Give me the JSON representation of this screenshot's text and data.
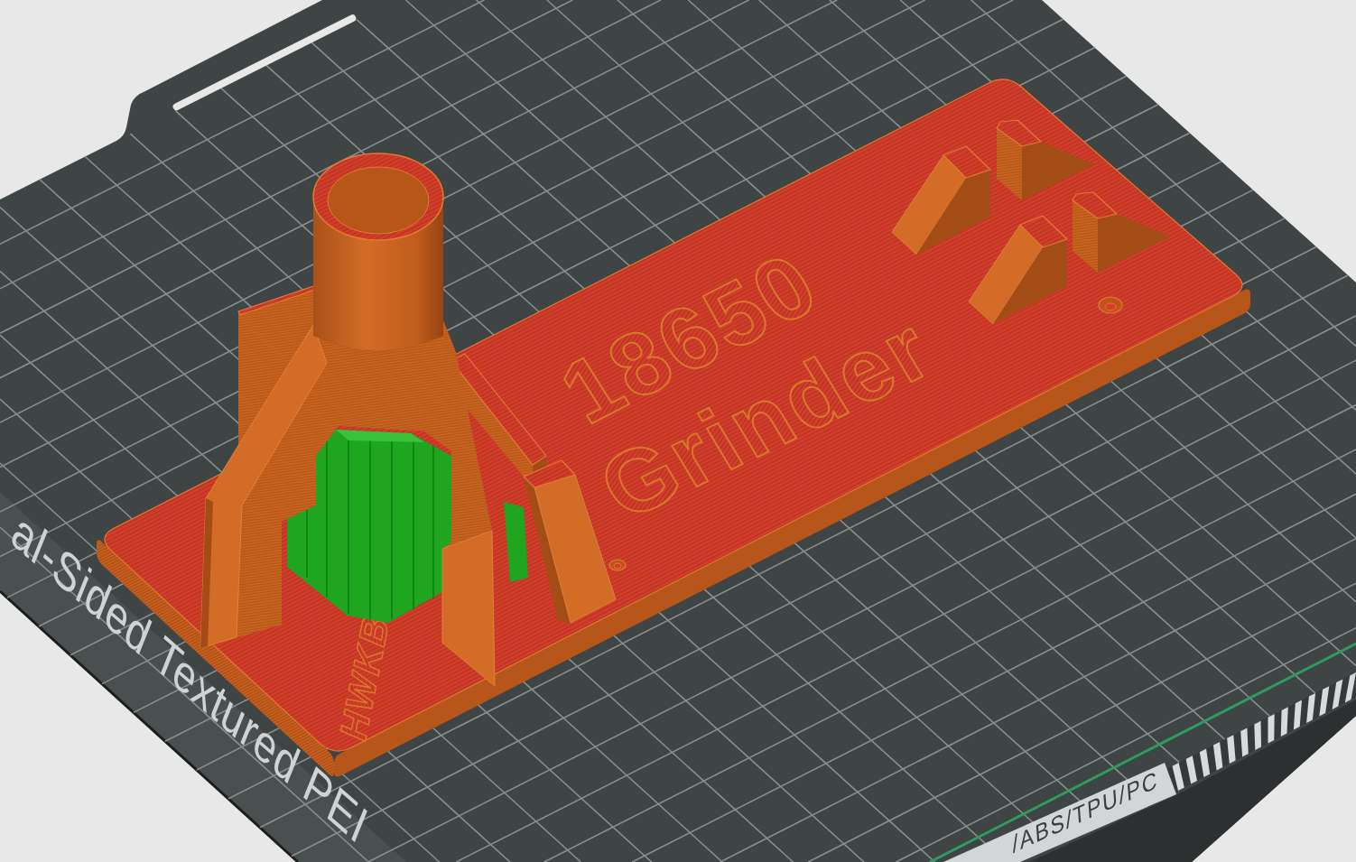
{
  "build_plate": {
    "plate_name": "al-Sided Textured PEI",
    "filament_tag": "/ABS/TPU/PC"
  },
  "model": {
    "title_lines": [
      "18650",
      "Grinder"
    ],
    "initials": "HWKB"
  }
}
